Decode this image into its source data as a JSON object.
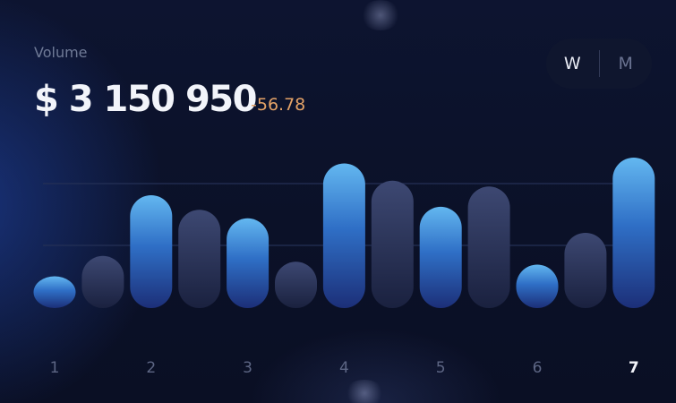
{
  "widget": {
    "label": "Volume",
    "amount": "$ 3 150 950",
    "change": "-56.78"
  },
  "toggle": {
    "options": [
      "W",
      "M"
    ],
    "selected": "W"
  },
  "colors": {
    "change": "#e4a267",
    "highlight_bar": "#4ea4e6",
    "muted_bar": "#3b4570",
    "background": "#0b1026"
  },
  "chart_data": {
    "type": "bar",
    "categories": [
      "1",
      "",
      "2",
      "",
      "3",
      "",
      "4",
      "",
      "5",
      "",
      "6",
      "",
      "7"
    ],
    "values": [
      1.1,
      1.8,
      3.9,
      3.4,
      3.1,
      1.6,
      5.0,
      4.4,
      3.5,
      4.2,
      1.5,
      2.6,
      5.2
    ],
    "highlighted": [
      true,
      false,
      true,
      false,
      true,
      false,
      true,
      false,
      true,
      false,
      true,
      false,
      true
    ],
    "active_label": "7",
    "ylim": [
      0,
      5.2
    ],
    "grid": true
  }
}
